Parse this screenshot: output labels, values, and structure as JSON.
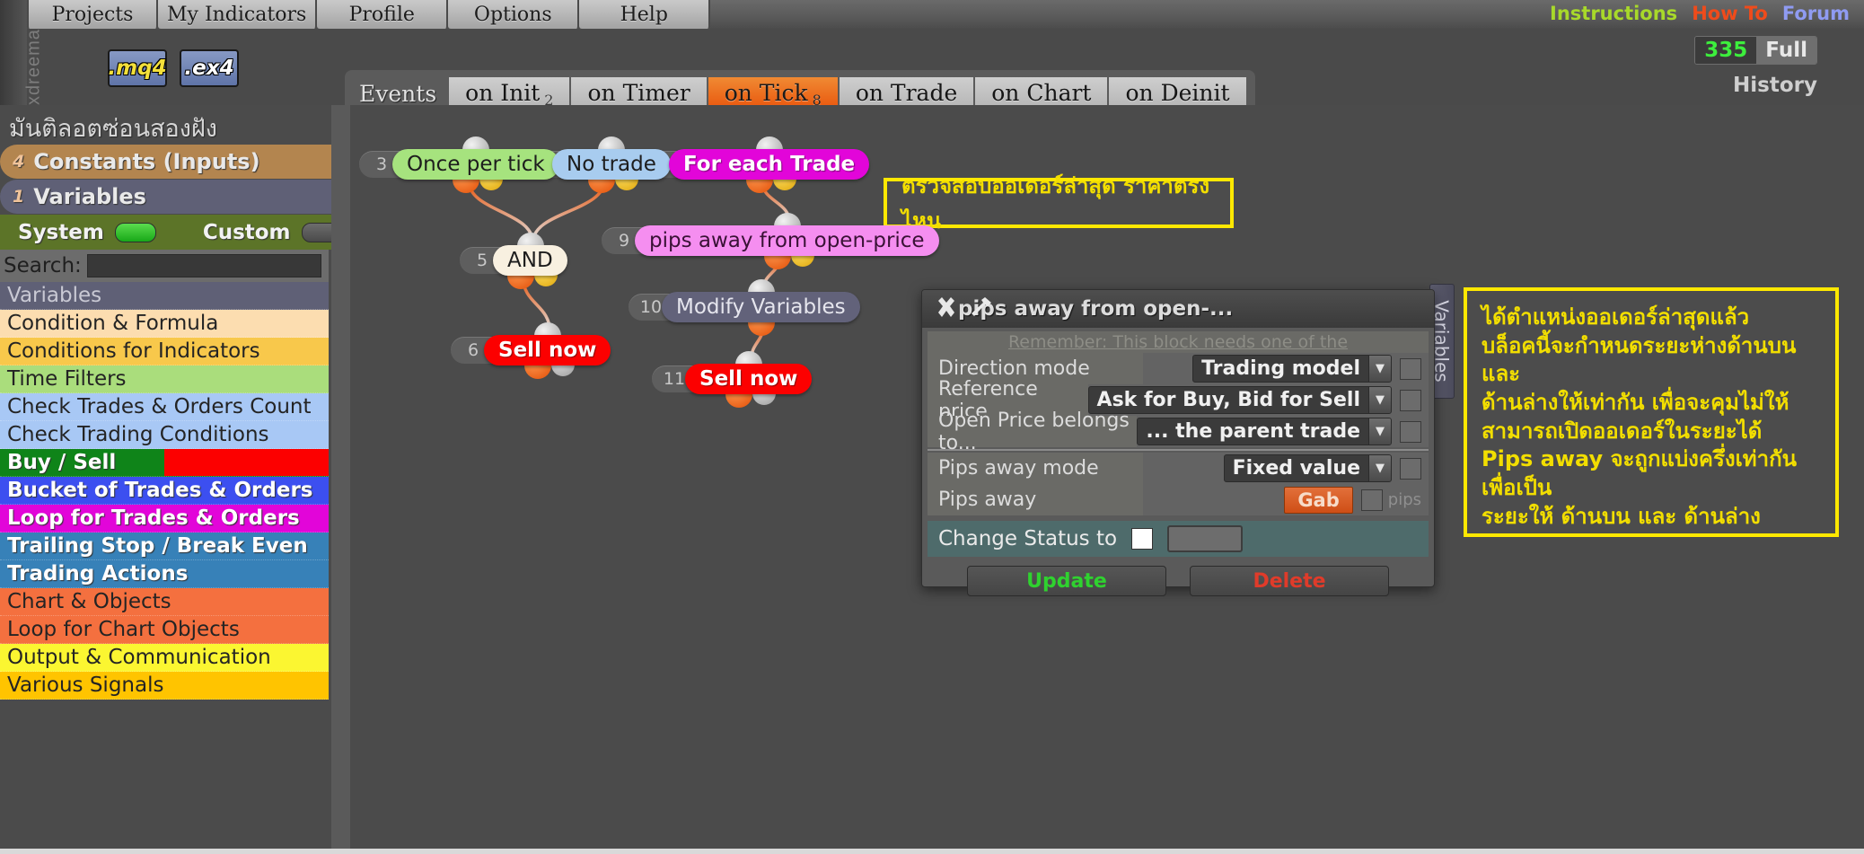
{
  "brand": "fxdreema",
  "topmenu": [
    "Projects",
    "My Indicators",
    "Profile",
    "Options",
    "Help"
  ],
  "toplinks": {
    "instructions": "Instructions",
    "howto": "How To",
    "forum": "Forum"
  },
  "counter": {
    "number": "335",
    "mode": "Full"
  },
  "history_label": "History",
  "filebuttons": {
    "mq4": ".mq4",
    "ex4": ".ex4"
  },
  "events": {
    "label": "Events",
    "tabs": [
      {
        "label": "on Init",
        "sub": "2",
        "active": false
      },
      {
        "label": "on Timer",
        "sub": "",
        "active": false
      },
      {
        "label": "on Tick",
        "sub": "8",
        "active": true
      },
      {
        "label": "on Trade",
        "sub": "",
        "active": false
      },
      {
        "label": "on Chart",
        "sub": "",
        "active": false
      },
      {
        "label": "on Deinit",
        "sub": "",
        "active": false
      }
    ]
  },
  "wrench_icon": "wrench-icon",
  "sidebar": {
    "project_title": "มันติลอตซ่อนสองฝัง",
    "constants": {
      "count": "4",
      "label": "Constants (Inputs)",
      "color": "#b3854f"
    },
    "variables": {
      "count": "1",
      "label": "Variables",
      "color": "#5f6076"
    },
    "system_label": "System",
    "custom_label": "Custom",
    "system_toggle": "on",
    "custom_toggle": "off",
    "search_label": "Search:",
    "search_value": "",
    "search_placeholder": "",
    "categories": [
      {
        "label": "Variables",
        "bg": "#5f6076",
        "fg": "#c9c9d4"
      },
      {
        "label": "Condition & Formula",
        "bg": "#fcddb0",
        "fg": "#242424"
      },
      {
        "label": "Conditions for Indicators",
        "bg": "#fcc council",
        "fg": "#242424"
      },
      {
        "label": "Time Filters",
        "bg": "#aadd7c",
        "fg": "#242424"
      },
      {
        "label": "Check Trades & Orders Count",
        "bg": "#a8c8f5",
        "fg": "#242424"
      },
      {
        "label": "Check Trading Conditions",
        "bg": "#a8c8f5",
        "fg": "#242424"
      },
      {
        "label": "Buy / Sell",
        "bg": "#0f8419",
        "fg": "#ffffff",
        "split": "#fc0000"
      },
      {
        "label": "Bucket of Trades & Orders",
        "bg": "#3c4ff0",
        "fg": "#ffffff"
      },
      {
        "label": "Loop for Trades & Orders",
        "bg": "#e205d9",
        "fg": "#ffffff"
      },
      {
        "label": "Trailing Stop / Break Even",
        "bg": "#3781b8",
        "fg": "#ffffff"
      },
      {
        "label": "Trading Actions",
        "bg": "#3781b8",
        "fg": "#ffffff"
      },
      {
        "label": "Chart & Objects",
        "bg": "#f4703f",
        "fg": "#242424"
      },
      {
        "label": "Loop for Chart Objects",
        "bg": "#f4703f",
        "fg": "#242424"
      },
      {
        "label": "Output & Communication",
        "bg": "#fbf631",
        "fg": "#242424"
      },
      {
        "label": "Various Signals",
        "bg": "#ffc400",
        "fg": "#242424"
      }
    ]
  },
  "canvas": {
    "nodes": [
      {
        "id": "3",
        "label": "Once per tick",
        "bg": "#a6e37e",
        "fg": "#1d1d1d",
        "bold": false
      },
      {
        "id": "4",
        "label": "No trade",
        "bg": "#a8ccef",
        "fg": "#1d1d1d",
        "bold": false
      },
      {
        "id": "8",
        "label": "For each Trade",
        "bg": "#e205d9",
        "fg": "#ffffff",
        "bold": true
      },
      {
        "id": "5",
        "label": "AND",
        "bg": "#f8f0e0",
        "fg": "#1d1d1d",
        "bold": false
      },
      {
        "id": "9",
        "label": "pips away from open-price",
        "bg": "#f58ef0",
        "fg": "#3a1236",
        "bold": false
      },
      {
        "id": "10",
        "label": "Modify Variables",
        "bg": "#62627a",
        "fg": "#e6e6ee",
        "bold": false
      },
      {
        "id": "6",
        "label": "Sell now",
        "bg": "#fc0000",
        "fg": "#ffffff",
        "bold": true
      },
      {
        "id": "11",
        "label": "Sell now",
        "bg": "#fc0000",
        "fg": "#ffffff",
        "bold": true
      }
    ],
    "note_top": "ตรวจสอบออเดอร์ล่าสุด ราคาตรงไหน",
    "note_side": [
      "ได้ตำแหน่งออเดอร์ล่าสุดแล้ว",
      "บล็อคนี้จะกำหนดระยะห่างด้านบนและ",
      "ด้านล่างให้เท่ากัน เพื่อจะคุมไม่ให้",
      "สามารถเปิดออเดอร์ในระยะได้",
      "Pips away จะถูกแบ่งครึ่งเท่ากันเพื่อเป็น",
      "ระยะให้ ด้านบน และ ด้านล่าง"
    ],
    "variables_tab": "Variables"
  },
  "dialog": {
    "title": "pips away from open-...",
    "close_icon": "close-icon",
    "pin_icon": "pin-icon",
    "remember": "Remember: This block needs one of the",
    "rows": [
      {
        "label": "Direction mode",
        "value": "Trading model",
        "checked": false
      },
      {
        "label": "Reference price",
        "value": "Ask for Buy, Bid for Sell",
        "checked": false
      },
      {
        "label": "Open Price belongs to...",
        "value": "... the parent trade",
        "checked": false
      }
    ],
    "rows2": [
      {
        "label": "Pips away mode",
        "value": "Fixed value",
        "checked": false
      }
    ],
    "pips_away_label": "Pips away",
    "gab_button": "Gab",
    "pips_unit": "pips",
    "status_label": "Change Status to",
    "status_value": "",
    "update_button": "Update",
    "delete_button": "Delete"
  },
  "colors": {
    "accent_orange": "#e8540c",
    "note_yellow": "#ffe800",
    "counter_green": "#3dee3d"
  }
}
